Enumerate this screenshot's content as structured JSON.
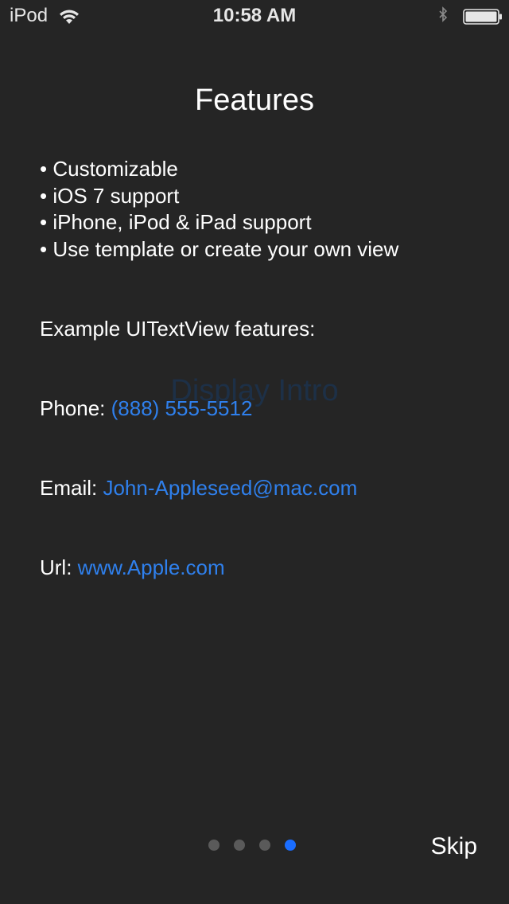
{
  "status_bar": {
    "carrier": "iPod",
    "time": "10:58 AM",
    "wifi_icon": "wifi-icon",
    "bluetooth_icon": "bluetooth-icon",
    "battery_icon": "battery-icon"
  },
  "background_label": "Display Intro",
  "title": "Features",
  "features": [
    "• Customizable",
    "• iOS 7 support",
    "• iPhone, iPod & iPad support",
    "• Use template or create your own view"
  ],
  "example_heading": "Example UITextView features:",
  "phone": {
    "label": "Phone: ",
    "value": "(888) 555-5512"
  },
  "email": {
    "label": "Email: ",
    "value": "John-Appleseed@mac.com"
  },
  "url": {
    "label": "Url: ",
    "value": "www.Apple.com"
  },
  "pagination": {
    "total": 4,
    "active_index": 3
  },
  "skip_label": "Skip",
  "colors": {
    "background": "#252525",
    "link": "#2f80ed",
    "active_dot": "#1a6dff",
    "inactive_dot": "#5a5a5a"
  }
}
